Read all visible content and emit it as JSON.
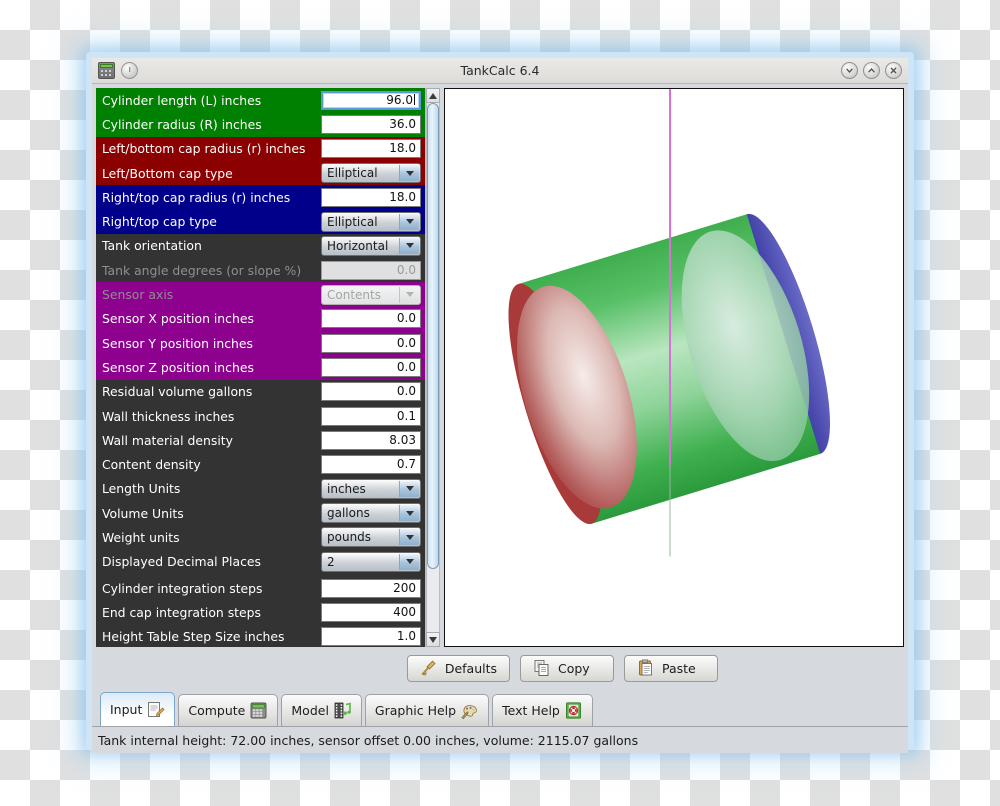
{
  "window": {
    "title": "TankCalc 6.4",
    "app_icon": "calculator-icon",
    "menu_button": "circle-button",
    "controls": {
      "minimize": "chevron-down-icon",
      "maximize": "chevron-up-icon",
      "close": "close-icon"
    }
  },
  "parameters": [
    {
      "label": "Cylinder length (L) inches",
      "value": "96.0",
      "type": "text",
      "group": "green",
      "focused": true,
      "disabled": false
    },
    {
      "label": "Cylinder radius (R) inches",
      "value": "36.0",
      "type": "text",
      "group": "green",
      "focused": false,
      "disabled": false
    },
    {
      "label": "Left/bottom cap radius (r) inches",
      "value": "18.0",
      "type": "text",
      "group": "red",
      "focused": false,
      "disabled": false
    },
    {
      "label": "Left/Bottom cap type",
      "value": "Elliptical",
      "type": "select",
      "group": "red",
      "focused": false,
      "disabled": false
    },
    {
      "label": "Right/top cap radius (r) inches",
      "value": "18.0",
      "type": "text",
      "group": "blue",
      "focused": false,
      "disabled": false
    },
    {
      "label": "Right/top cap type",
      "value": "Elliptical",
      "type": "select",
      "group": "blue",
      "focused": false,
      "disabled": false
    },
    {
      "label": "Tank orientation",
      "value": "Horizontal",
      "type": "select",
      "group": "dark",
      "focused": false,
      "disabled": false
    },
    {
      "label": "Tank angle degrees (or slope %)",
      "value": "0.0",
      "type": "text",
      "group": "dark",
      "focused": false,
      "disabled": true
    },
    {
      "label": "Sensor axis",
      "value": "Contents",
      "type": "select",
      "group": "purple",
      "focused": false,
      "disabled": true
    },
    {
      "label": "Sensor X position inches",
      "value": "0.0",
      "type": "text",
      "group": "purple",
      "focused": false,
      "disabled": false
    },
    {
      "label": "Sensor Y position inches",
      "value": "0.0",
      "type": "text",
      "group": "purple",
      "focused": false,
      "disabled": false
    },
    {
      "label": "Sensor Z position inches",
      "value": "0.0",
      "type": "text",
      "group": "purple",
      "focused": false,
      "disabled": false
    },
    {
      "label": "Residual volume gallons",
      "value": "0.0",
      "type": "text",
      "group": "dark",
      "focused": false,
      "disabled": false
    },
    {
      "label": "Wall thickness inches",
      "value": "0.1",
      "type": "text",
      "group": "dark",
      "focused": false,
      "disabled": false
    },
    {
      "label": "Wall material density",
      "value": "8.03",
      "type": "text",
      "group": "dark",
      "focused": false,
      "disabled": false
    },
    {
      "label": "Content density",
      "value": "0.7",
      "type": "text",
      "group": "dark",
      "focused": false,
      "disabled": false
    },
    {
      "label": "Length Units",
      "value": "inches",
      "type": "select",
      "group": "dark",
      "focused": false,
      "disabled": false
    },
    {
      "label": "Volume Units",
      "value": "gallons",
      "type": "select",
      "group": "dark",
      "focused": false,
      "disabled": false
    },
    {
      "label": "Weight units",
      "value": "pounds",
      "type": "select",
      "group": "dark",
      "focused": false,
      "disabled": false
    },
    {
      "label": "Displayed Decimal Places",
      "value": "2",
      "type": "select",
      "group": "dark",
      "focused": false,
      "disabled": false
    },
    {
      "label": "Cylinder integration steps",
      "value": "200",
      "type": "text",
      "group": "dark",
      "focused": false,
      "disabled": false,
      "separator_before": true
    },
    {
      "label": "End cap integration steps",
      "value": "400",
      "type": "text",
      "group": "dark",
      "focused": false,
      "disabled": false
    },
    {
      "label": "Height Table Step Size inches",
      "value": "1.0",
      "type": "text",
      "group": "dark",
      "focused": false,
      "disabled": false
    }
  ],
  "graphic": {
    "description": "3D rendered horizontal cylindrical tank",
    "cylinder_color": "#33aa44",
    "left_cap_color": "#b03a3a",
    "right_cap_color": "#3a3ab0",
    "sensor_line_color": "#d96fd9"
  },
  "toolbar": [
    {
      "label": "Defaults",
      "icon": "broom-icon"
    },
    {
      "label": "Copy",
      "icon": "copy-pages-icon"
    },
    {
      "label": "Paste",
      "icon": "clipboard-icon"
    }
  ],
  "tabs": [
    {
      "label": "Input",
      "icon": "notepad-pencil-icon",
      "active": true
    },
    {
      "label": "Compute",
      "icon": "calculator-icon",
      "active": false
    },
    {
      "label": "Model",
      "icon": "film-note-icon",
      "active": false
    },
    {
      "label": "Graphic Help",
      "icon": "palette-icon",
      "active": false
    },
    {
      "label": "Text Help",
      "icon": "lifesaver-book-icon",
      "active": false
    }
  ],
  "status": "Tank internal height: 72.00 inches, sensor offset 0.00 inches, volume: 2115.07 gallons"
}
